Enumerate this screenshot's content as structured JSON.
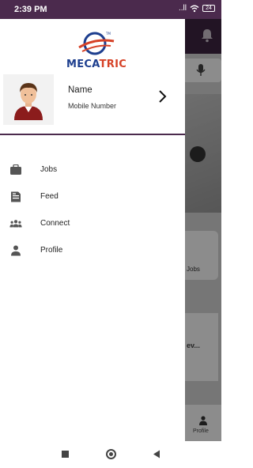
{
  "status_bar": {
    "time": "2:39 PM",
    "signal_text": "..ll",
    "battery_level": "24"
  },
  "drawer": {
    "logo": {
      "text_part1": "MECA",
      "text_part2": "TRIC"
    },
    "profile": {
      "name": "Name",
      "mobile": "Mobile Number"
    },
    "menu_items": [
      {
        "label": "Jobs",
        "icon": "briefcase-icon"
      },
      {
        "label": "Feed",
        "icon": "feed-icon"
      },
      {
        "label": "Connect",
        "icon": "people-icon"
      },
      {
        "label": "Profile",
        "icon": "person-icon"
      }
    ]
  },
  "background_app": {
    "card_label": "Jobs",
    "card2_label": "ev...",
    "bottom_nav_label": "Profile"
  },
  "colors": {
    "primary": "#4b2a4d",
    "logo_blue": "#1d3e8e",
    "logo_red": "#d64227"
  }
}
